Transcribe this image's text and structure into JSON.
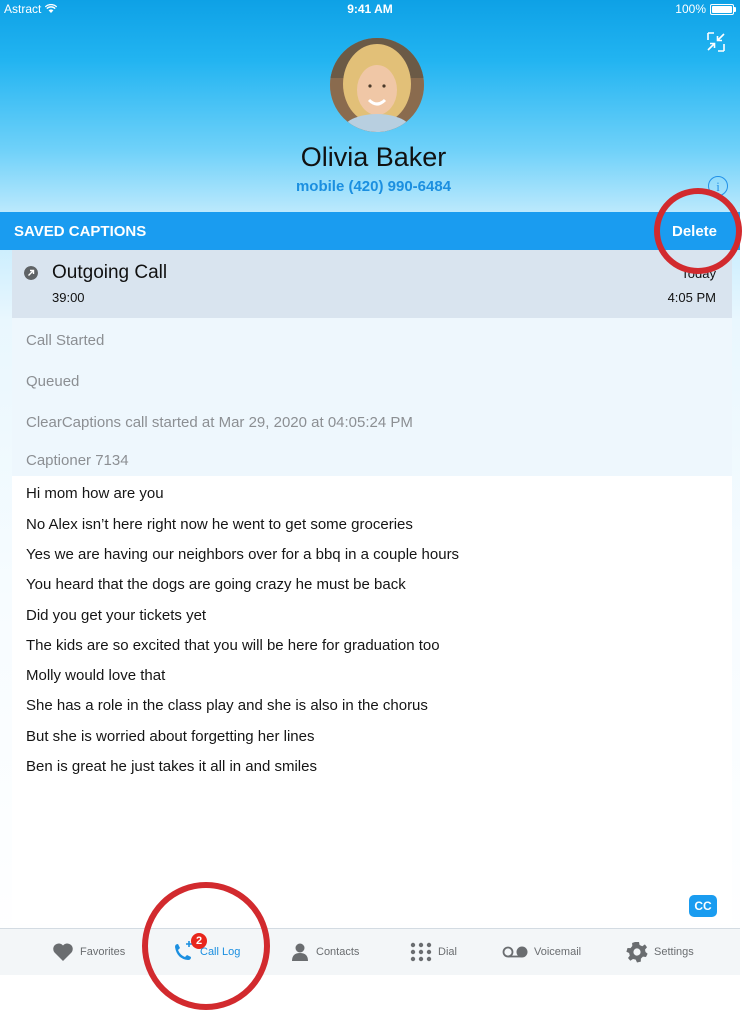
{
  "status_bar": {
    "carrier": "Astract",
    "time": "9:41 AM",
    "battery": "100%"
  },
  "contact": {
    "name": "Olivia Baker",
    "phone": "mobile (420) 990-6484"
  },
  "section": {
    "title": "SAVED CAPTIONS",
    "delete_label": "Delete"
  },
  "call": {
    "type": "Outgoing Call",
    "duration": "39:00",
    "day": "Today",
    "time": "4:05 PM"
  },
  "meta_lines": [
    "Call Started",
    "Queued",
    "ClearCaptions call started at Mar 29, 2020 at 04:05:24 PM",
    "Captioner 7134"
  ],
  "captions": [
    "Hi mom how are you",
    "No Alex isn’t here right now he went to get some groceries",
    "Yes we are having our neighbors over for a bbq in a couple hours",
    "You heard that the dogs are going crazy he must be back",
    "Did you get your tickets yet",
    "The kids are so excited that you will be here for graduation too",
    "Molly would love that",
    "She has a role in the class play and she is also in the chorus",
    "But she is worried about forgetting her lines",
    "Ben is great he just takes it all in and smiles"
  ],
  "cc_label": "CC",
  "tabs": [
    {
      "label": "Favorites",
      "icon": "heart-icon"
    },
    {
      "label": "Call Log",
      "icon": "call-log-icon",
      "badge": "2",
      "active": true
    },
    {
      "label": "Contacts",
      "icon": "person-icon"
    },
    {
      "label": "Dial",
      "icon": "keypad-icon"
    },
    {
      "label": "Voicemail",
      "icon": "voicemail-icon"
    },
    {
      "label": "Settings",
      "icon": "gear-icon"
    }
  ],
  "colors": {
    "accent": "#1a9cf0",
    "highlight": "#d22a2e",
    "badge": "#e8261c"
  }
}
